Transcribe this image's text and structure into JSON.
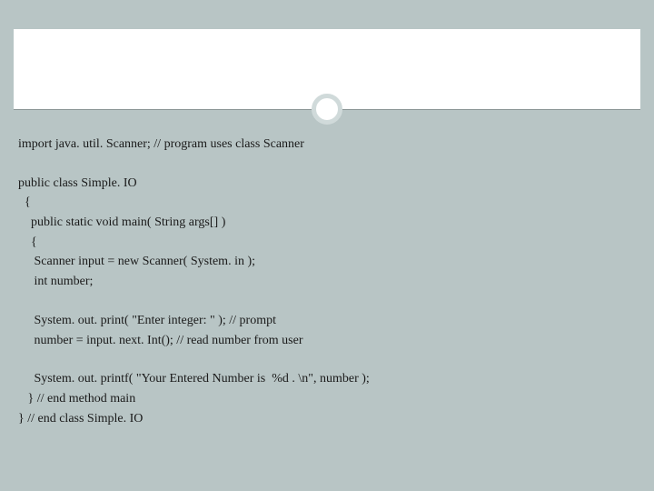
{
  "code": {
    "line1": "import java. util. Scanner; // program uses class Scanner",
    "line2": "public class Simple. IO",
    "line3": "  {",
    "line4": "    public static void main( String args[] )",
    "line5": "    {",
    "line6": "     Scanner input = new Scanner( System. in );",
    "line7": "     int number;",
    "line8": "     System. out. print( \"Enter integer: \" ); // prompt",
    "line9": "     number = input. next. Int(); // read number from user",
    "line10": "     System. out. printf( \"Your Entered Number is  %d . \\n\", number );",
    "line11": "   } // end method main",
    "line12": "} // end class Simple. IO"
  }
}
